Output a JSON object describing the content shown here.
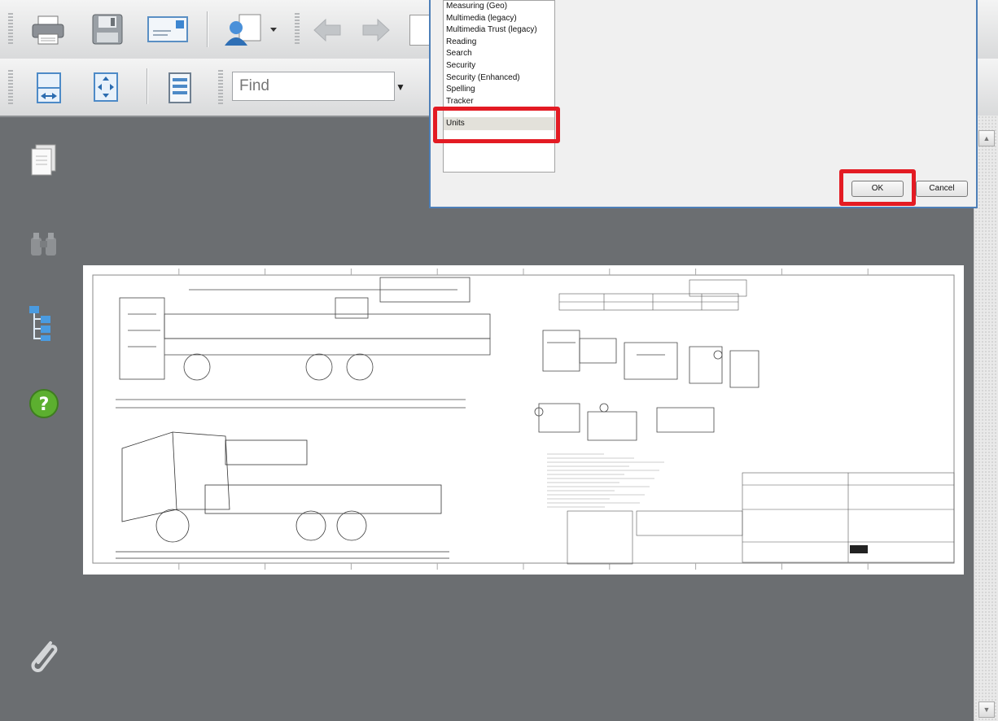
{
  "toolbar": {
    "find_placeholder": "Find",
    "find_dropdown_glyph": "▼",
    "icons": [
      "printer-icon",
      "save-icon",
      "email-icon",
      "collaborate-icon",
      "back-arrow-icon",
      "forward-arrow-icon",
      "fit-width-icon",
      "fit-page-icon",
      "single-page-icon"
    ]
  },
  "nav_panel": {
    "icons": [
      "pages-icon",
      "binoculars-icon",
      "bookmarks-tree-icon",
      "help-icon",
      "attachment-icon"
    ]
  },
  "dialog": {
    "categories": [
      "Measuring (Geo)",
      "Multimedia (legacy)",
      "Multimedia Trust (legacy)",
      "Reading",
      "Search",
      "Security",
      "Security (Enhanced)",
      "Spelling",
      "Tracker"
    ],
    "selected_category": "Units",
    "ok_label": "OK",
    "cancel_label": "Cancel"
  },
  "scrollbar": {
    "up_glyph": "▲",
    "down_glyph": "▼"
  },
  "colors": {
    "highlight_red": "#e31b23",
    "dialog_border": "#4d7fb8",
    "viewer_bg": "#6b6e71"
  }
}
